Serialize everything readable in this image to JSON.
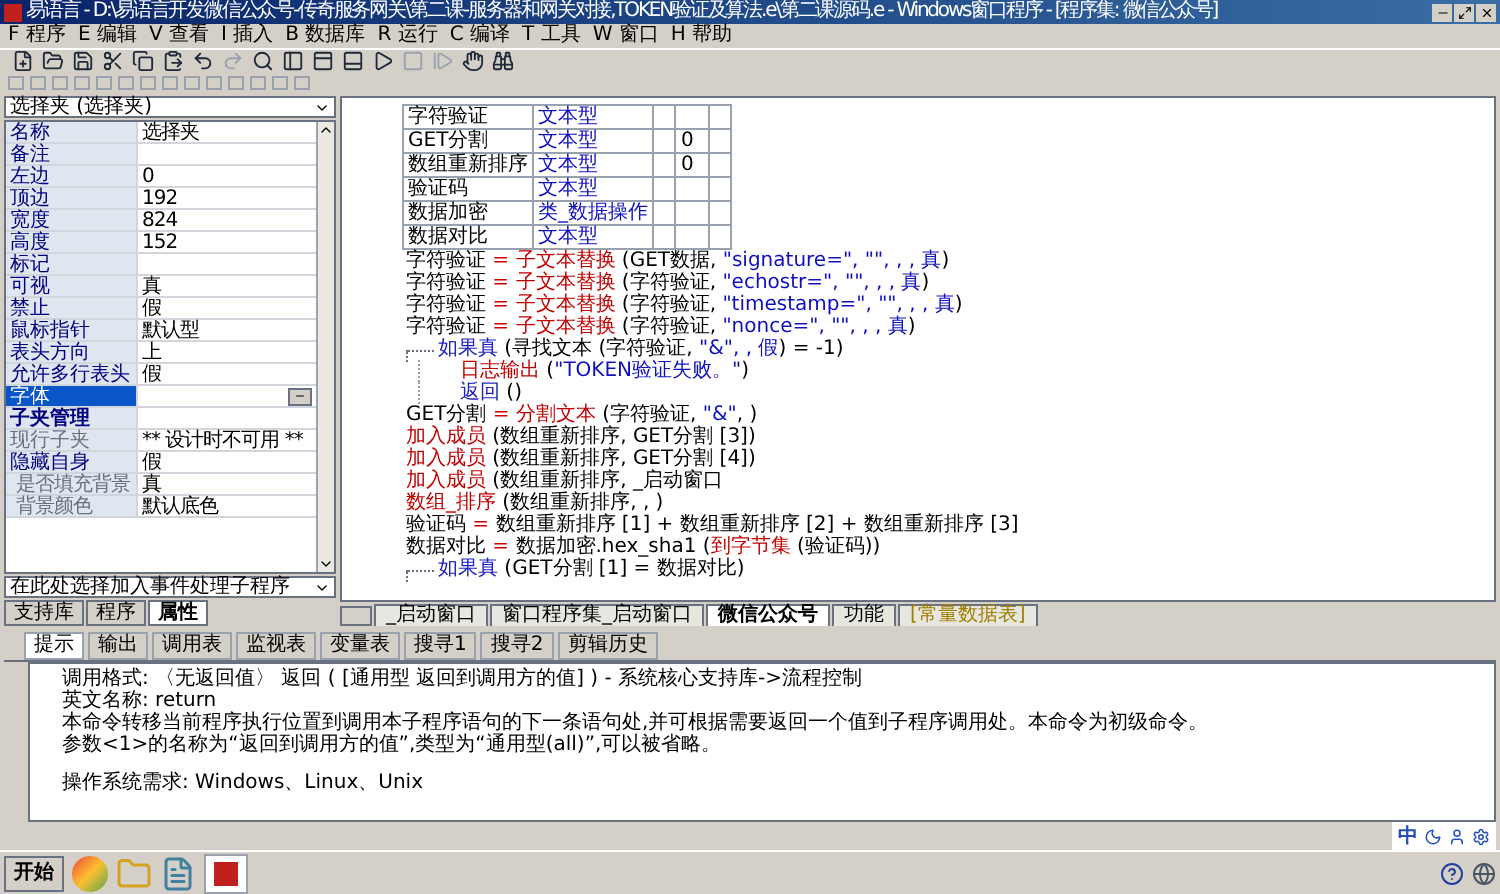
{
  "window": {
    "title": "易语言 - D:\\易语言开发微信公众号-传奇服务网关\\第二课-服务器和网关对接,TOKEN验证及算法.e\\第二课源码.e - Windows窗口程序 - [程序集: 微信公众号]"
  },
  "menu": [
    {
      "hotkey": "F",
      "label": "程序"
    },
    {
      "hotkey": "E",
      "label": "编辑"
    },
    {
      "hotkey": "V",
      "label": "查看"
    },
    {
      "hotkey": "I",
      "label": "插入"
    },
    {
      "hotkey": "B",
      "label": "数据库"
    },
    {
      "hotkey": "R",
      "label": "运行"
    },
    {
      "hotkey": "C",
      "label": "编译"
    },
    {
      "hotkey": "T",
      "label": "工具"
    },
    {
      "hotkey": "W",
      "label": "窗口"
    },
    {
      "hotkey": "H",
      "label": "帮助"
    }
  ],
  "properties": {
    "component": "选择夹 (选择夹)",
    "rows": [
      {
        "name": "名称",
        "value": "选择夹",
        "kind": "normal",
        "selected": false
      },
      {
        "name": "备注",
        "value": "",
        "kind": "normal",
        "selected": false
      },
      {
        "name": "左边",
        "value": "0",
        "kind": "normal",
        "selected": false
      },
      {
        "name": "顶边",
        "value": "192",
        "kind": "normal",
        "selected": false
      },
      {
        "name": "宽度",
        "value": "824",
        "kind": "normal",
        "selected": false
      },
      {
        "name": "高度",
        "value": "152",
        "kind": "normal",
        "selected": false
      },
      {
        "name": "标记",
        "value": "",
        "kind": "normal",
        "selected": false
      },
      {
        "name": "可视",
        "value": "真",
        "kind": "normal",
        "selected": false
      },
      {
        "name": "禁止",
        "value": "假",
        "kind": "normal",
        "selected": false
      },
      {
        "name": "鼠标指针",
        "value": "默认型",
        "kind": "normal",
        "selected": false
      },
      {
        "name": "表头方向",
        "value": "上",
        "kind": "normal",
        "selected": false
      },
      {
        "name": "允许多行表头",
        "value": "假",
        "kind": "normal",
        "selected": false
      },
      {
        "name": "字体",
        "value": "",
        "kind": "button",
        "selected": true
      },
      {
        "name": "子夹管理",
        "value": "",
        "kind": "header",
        "selected": false
      },
      {
        "name": "现行子夹",
        "value": "** 设计时不可用 **",
        "kind": "disabled",
        "selected": false
      },
      {
        "name": "隐藏自身",
        "value": "假",
        "kind": "normal",
        "selected": false,
        "children": [
          {
            "name": "是否填充背景",
            "value": "真",
            "kind": "disabled",
            "selected": false
          },
          {
            "name": "背景颜色",
            "value": "默认底色",
            "kind": "disabled",
            "selected": false
          }
        ]
      }
    ],
    "event_select": "在此处选择加入事件处理子程序",
    "tabs": [
      {
        "label": "支持库",
        "selected": false
      },
      {
        "label": "程序",
        "selected": false
      },
      {
        "label": "属性",
        "selected": true
      }
    ]
  },
  "variables": [
    {
      "name": "字符验证",
      "type": "文本型"
    },
    {
      "name": "GET分割",
      "type": "文本型",
      "column_4": "0"
    },
    {
      "name": "数组重新排序",
      "type": "文本型",
      "column_4": "0"
    },
    {
      "name": "验证码",
      "type": "文本型"
    },
    {
      "name": "数据加密",
      "type": "类_数据操作"
    },
    {
      "name": "数据对比",
      "type": "文本型"
    }
  ],
  "code": [
    {
      "kind": "statement",
      "parts": [
        {
          "kind": "var",
          "text": "字符验证"
        },
        {
          "kind": "op",
          "text": " = "
        },
        {
          "kind": "func",
          "text": "子文本替换"
        },
        {
          "kind": "var",
          "text": " (GET数据, "
        },
        {
          "kind": "str",
          "text": "\"signature=\", \"\", , , 真"
        },
        {
          "kind": "var",
          "text": ")"
        }
      ]
    },
    {
      "kind": "statement",
      "parts": [
        {
          "kind": "var",
          "text": "字符验证"
        },
        {
          "kind": "op",
          "text": " = "
        },
        {
          "kind": "func",
          "text": "子文本替换"
        },
        {
          "kind": "var",
          "text": " (字符验证, "
        },
        {
          "kind": "str",
          "text": "\"echostr=\", \"\", , , 真"
        },
        {
          "kind": "var",
          "text": ")"
        }
      ]
    },
    {
      "kind": "statement",
      "parts": [
        {
          "kind": "var",
          "text": "字符验证"
        },
        {
          "kind": "op",
          "text": " = "
        },
        {
          "kind": "func",
          "text": "子文本替换"
        },
        {
          "kind": "var",
          "text": " (字符验证, "
        },
        {
          "kind": "str",
          "text": "\"timestamp=\", \"\", , , 真"
        },
        {
          "kind": "var",
          "text": ")"
        }
      ]
    },
    {
      "kind": "statement",
      "parts": [
        {
          "kind": "var",
          "text": "字符验证"
        },
        {
          "kind": "op",
          "text": " = "
        },
        {
          "kind": "func",
          "text": "子文本替换"
        },
        {
          "kind": "var",
          "text": " (字符验证, "
        },
        {
          "kind": "str",
          "text": "\"nonce=\", \"\", , , 真"
        },
        {
          "kind": "var",
          "text": ")"
        }
      ]
    },
    {
      "kind": "flow",
      "parts": [
        {
          "kind": "keyword",
          "text": "如果真"
        },
        {
          "kind": "var",
          "text": " (寻找文本 (字符验证, "
        },
        {
          "kind": "str",
          "text": "\"&\", , 假"
        },
        {
          "kind": "var",
          "text": ") = -1)"
        }
      ]
    },
    {
      "kind": "nested",
      "parts": [
        {
          "kind": "func",
          "text": "日志输出"
        },
        {
          "kind": "var",
          "text": " ("
        },
        {
          "kind": "str",
          "text": "\"TOKEN验证失败。\""
        },
        {
          "kind": "var",
          "text": ")"
        }
      ]
    },
    {
      "kind": "nested",
      "parts": [
        {
          "kind": "keyword",
          "text": "返回"
        },
        {
          "kind": "var",
          "text": " ()"
        }
      ]
    },
    {
      "kind": "statement",
      "parts": [
        {
          "kind": "var",
          "text": "GET分割"
        },
        {
          "kind": "op",
          "text": " = "
        },
        {
          "kind": "func",
          "text": "分割文本"
        },
        {
          "kind": "var",
          "text": " (字符验证, "
        },
        {
          "kind": "str",
          "text": "\"&\""
        },
        {
          "kind": "var",
          "text": ", )"
        }
      ]
    },
    {
      "kind": "statement",
      "parts": [
        {
          "kind": "func",
          "text": "加入成员"
        },
        {
          "kind": "var",
          "text": " (数组重新排序, GET分割 [3])"
        }
      ]
    },
    {
      "kind": "statement",
      "parts": [
        {
          "kind": "func",
          "text": "加入成员"
        },
        {
          "kind": "var",
          "text": " (数组重新排序, GET分割 [4])"
        }
      ]
    },
    {
      "kind": "statement",
      "parts": [
        {
          "kind": "func",
          "text": "加入成员"
        },
        {
          "kind": "var",
          "text": " (数组重新排序, _启动窗口"
        }
      ]
    },
    {
      "kind": "statement",
      "parts": [
        {
          "kind": "func",
          "text": "数组_排序"
        },
        {
          "kind": "var",
          "text": " (数组重新排序, , )"
        }
      ]
    },
    {
      "kind": "statement",
      "parts": [
        {
          "kind": "var",
          "text": "验证码"
        },
        {
          "kind": "op",
          "text": " = "
        },
        {
          "kind": "var",
          "text": "数组重新排序 [1] + 数组重新排序 [2] + 数组重新排序 [3]"
        }
      ]
    },
    {
      "kind": "statement",
      "parts": [
        {
          "kind": "var",
          "text": "数据对比"
        },
        {
          "kind": "op",
          "text": " = "
        },
        {
          "kind": "var",
          "text": "数据加密.hex_sha1 ("
        },
        {
          "kind": "func",
          "text": "到字节集"
        },
        {
          "kind": "var",
          "text": " (验证码))"
        }
      ]
    },
    {
      "kind": "flow",
      "parts": [
        {
          "kind": "keyword",
          "text": "如果真"
        },
        {
          "kind": "var",
          "text": " (GET分割 [1] = 数据对比)"
        }
      ]
    }
  ],
  "editor_tabs": [
    {
      "label": "_启动窗口",
      "selected": false,
      "kind": "normal"
    },
    {
      "label": "窗口程序集_启动窗口",
      "selected": false,
      "kind": "normal"
    },
    {
      "label": "微信公众号",
      "selected": true,
      "kind": "normal"
    },
    {
      "label": "功能",
      "selected": false,
      "kind": "normal"
    },
    {
      "label": "[常量数据表]",
      "selected": false,
      "kind": "constant"
    }
  ],
  "bottom_tabs": [
    {
      "label": "提示",
      "selected": true
    },
    {
      "label": "输出",
      "selected": false
    },
    {
      "label": "调用表",
      "selected": false
    },
    {
      "label": "监视表",
      "selected": false
    },
    {
      "label": "变量表",
      "selected": false
    },
    {
      "label": "搜寻1",
      "selected": false
    },
    {
      "label": "搜寻2",
      "selected": false
    },
    {
      "label": "剪辑历史",
      "selected": false
    }
  ],
  "hint_lines": [
    "调用格式: 〈无返回值〉 返回 ( [通用型 返回到调用方的值] ) - 系统核心支持库->流程控制",
    "英文名称: return",
    "本命令转移当前程序执行位置到调用本子程序语句的下一条语句处,并可根据需要返回一个值到子程序调用处。本命令为初级命令。",
    "参数<1>的名称为“返回到调用方的值”,类型为“通用型(all)”,可以被省略。",
    "操作系统需求: Windows、Linux、Unix"
  ],
  "ime_bar": {
    "mode": "中"
  },
  "taskbar": {
    "start": "开始"
  }
}
